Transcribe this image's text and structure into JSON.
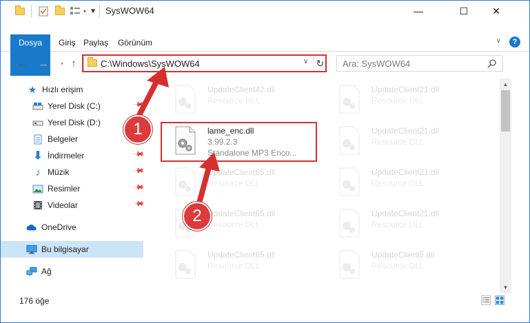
{
  "window": {
    "title": "SysWOW64",
    "minimize": "—",
    "maximize": "☐",
    "close": "✕"
  },
  "ribbon": {
    "tabs": [
      "Dosya",
      "Giriş",
      "Paylaş",
      "Görünüm"
    ],
    "help_icon": "?"
  },
  "address": {
    "path": "C:\\Windows\\SysWOW64",
    "dropdown": "∨",
    "refresh": "↻"
  },
  "search": {
    "placeholder": "Ara: SysWOW64"
  },
  "sidebar": {
    "items": [
      {
        "label": "Hızlı erişim",
        "icon": "star-icon"
      },
      {
        "label": "Yerel Disk (C:)",
        "icon": "drive-icon",
        "pinned": true
      },
      {
        "label": "Yerel Disk (D:)",
        "icon": "drive-icon"
      },
      {
        "label": "Belgeler",
        "icon": "documents-icon",
        "pinned": true
      },
      {
        "label": "İndirmeler",
        "icon": "downloads-icon",
        "pinned": true
      },
      {
        "label": "Müzik",
        "icon": "music-icon",
        "pinned": true
      },
      {
        "label": "Resimler",
        "icon": "pictures-icon",
        "pinned": true
      },
      {
        "label": "Videolar",
        "icon": "videos-icon",
        "pinned": true
      },
      {
        "label": "OneDrive",
        "icon": "onedrive-icon"
      },
      {
        "label": "Bu bilgisayar",
        "icon": "pc-icon",
        "selected": true
      },
      {
        "label": "Ağ",
        "icon": "network-icon"
      }
    ]
  },
  "files": [
    {
      "name": "UpdateClient42.dll",
      "desc": "Resource DLL",
      "faded": true
    },
    {
      "name": "UpdateClient21.dll",
      "desc": "Resource DLL",
      "faded": true
    },
    {
      "name": "lame_enc.dll",
      "desc": "3.99.2.3",
      "desc2": "Standalone MP3 Enco...",
      "faded": false
    },
    {
      "name": "UpdateClient21.dll",
      "desc": "Resource DLL",
      "faded": true
    },
    {
      "name": "UpdateClient65.dll",
      "desc": "Resource DLL",
      "faded": true
    },
    {
      "name": "UpdateClient21.dll",
      "desc": "Resource DLL",
      "faded": true
    },
    {
      "name": "UpdateClient65.dll",
      "desc": "Resource DLL",
      "faded": true
    },
    {
      "name": "UpdateClient21.dll",
      "desc": "Resource DLL",
      "faded": true
    },
    {
      "name": "UpdateClient65.dll",
      "desc": "Resource DLL",
      "faded": true
    },
    {
      "name": "UpdateClient5.dll",
      "desc": "Resource DLL",
      "faded": true
    }
  ],
  "status": {
    "count": "176 öğe"
  },
  "annotations": {
    "step1": "1",
    "step2": "2"
  },
  "colors": {
    "accent": "#1979ca",
    "highlight": "#d62f2f",
    "selected": "#cce4f7"
  }
}
